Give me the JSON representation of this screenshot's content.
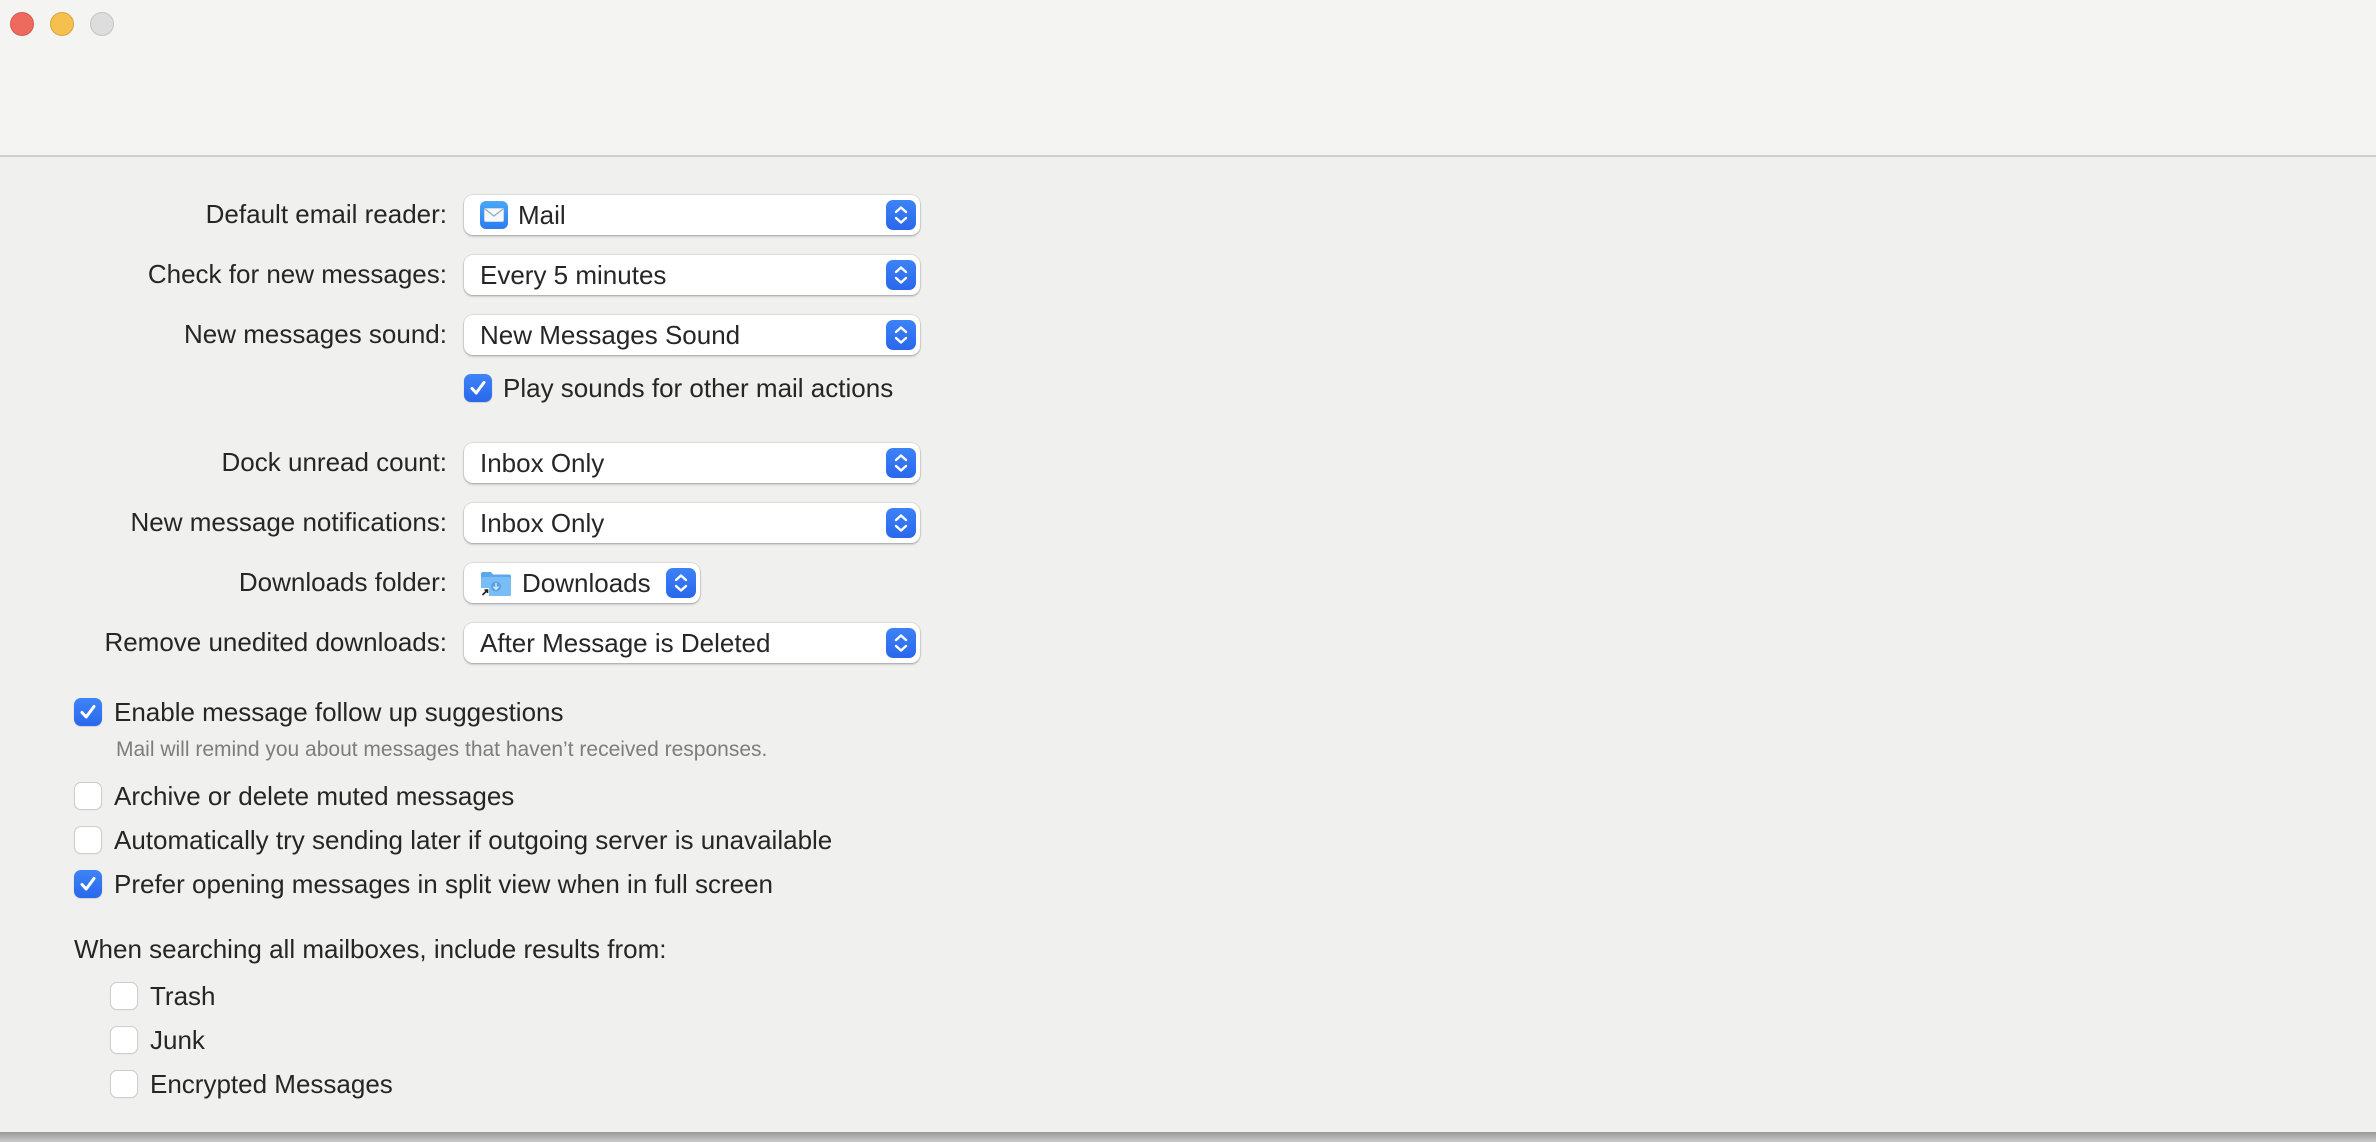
{
  "window": {
    "controls": [
      {
        "name": "close",
        "color": "#ee6a5f"
      },
      {
        "name": "minimize",
        "color": "#f6c04f"
      },
      {
        "name": "zoom",
        "color": "#dddddd"
      }
    ]
  },
  "accent_color": "#2f6ff0",
  "settings": {
    "default_email_reader": {
      "label": "Default email reader:",
      "value": "Mail",
      "icon": "mail-app-icon"
    },
    "check_new_messages": {
      "label": "Check for new messages:",
      "value": "Every 5 minutes"
    },
    "new_messages_sound": {
      "label": "New messages sound:",
      "value": "New Messages Sound"
    },
    "play_sounds": {
      "label": "Play sounds for other mail actions",
      "checked": true
    },
    "dock_unread_count": {
      "label": "Dock unread count:",
      "value": "Inbox Only"
    },
    "new_message_notifications": {
      "label": "New message notifications:",
      "value": "Inbox Only"
    },
    "downloads_folder": {
      "label": "Downloads folder:",
      "value": "Downloads",
      "icon": "downloads-folder-icon"
    },
    "remove_unedited_downloads": {
      "label": "Remove unedited downloads:",
      "value": "After Message is Deleted"
    }
  },
  "options": [
    {
      "label": "Enable message follow up suggestions",
      "checked": true,
      "hint": "Mail will remind you about messages that haven’t received responses."
    },
    {
      "label": "Archive or delete muted messages",
      "checked": false
    },
    {
      "label": "Automatically try sending later if outgoing server is unavailable",
      "checked": false
    },
    {
      "label": "Prefer opening messages in split view when in full screen",
      "checked": true
    }
  ],
  "search": {
    "label": "When searching all mailboxes, include results from:",
    "items": [
      {
        "label": "Trash",
        "checked": false
      },
      {
        "label": "Junk",
        "checked": false
      },
      {
        "label": "Encrypted Messages",
        "checked": false
      }
    ]
  }
}
